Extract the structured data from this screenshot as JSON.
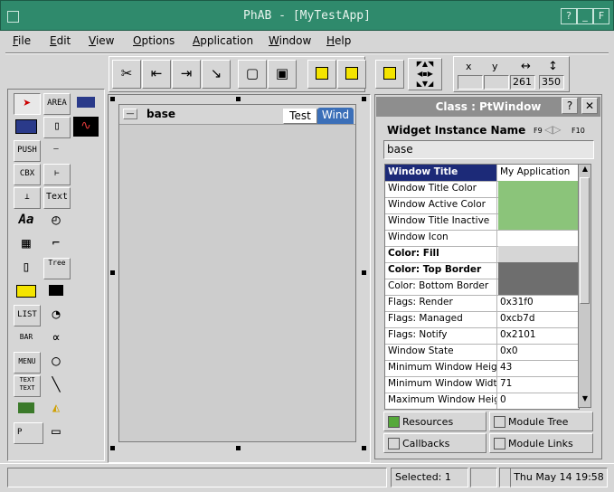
{
  "window": {
    "title": "PhAB - [MyTestApp]"
  },
  "menubar": {
    "items": [
      {
        "label": "File",
        "accel": "F"
      },
      {
        "label": "Edit",
        "accel": "E"
      },
      {
        "label": "View",
        "accel": "V"
      },
      {
        "label": "Options",
        "accel": "O"
      },
      {
        "label": "Application",
        "accel": "A"
      },
      {
        "label": "Window",
        "accel": "W"
      },
      {
        "label": "Help",
        "accel": "H"
      }
    ]
  },
  "toolbar": {
    "coords": {
      "x_label": "x",
      "y_label": "y",
      "w_label": "↔",
      "h_label": "↕",
      "x": "",
      "y": "",
      "w": "261",
      "h": "350"
    }
  },
  "palette": {
    "area": "AREA",
    "push": "PUSH",
    "cbx": "CBX",
    "text": "Text",
    "aa": "Aa",
    "tree_label": "Tree",
    "list": "LIST",
    "bar": "BAR",
    "menu": "MENU",
    "text_text": "TEXT TEXT",
    "p": "P"
  },
  "base_window": {
    "title": "base",
    "tabs": [
      "Test",
      "Wind"
    ]
  },
  "class_panel": {
    "title": "Class : PtWindow",
    "instance_label": "Widget Instance Name",
    "f9": "F9",
    "f10": "F10",
    "instance_value": "base",
    "resources": [
      {
        "name": "Window Title",
        "value": "My Application",
        "selected": true
      },
      {
        "name": "Window Title Color",
        "value": "",
        "swatch": "#8bc47a"
      },
      {
        "name": "Window Active Color",
        "value": "",
        "swatch": "#8bc47a"
      },
      {
        "name": "Window Title Inactive",
        "value": "",
        "swatch": "#8bc47a"
      },
      {
        "name": "Window Icon",
        "value": ""
      },
      {
        "name": "Color: Fill",
        "value": "",
        "swatch": "#d6d6d6",
        "bold": true
      },
      {
        "name": "Color: Top Border",
        "value": "",
        "swatch": "#6e6e6e",
        "bold": true
      },
      {
        "name": "Color: Bottom Border",
        "value": "",
        "swatch": "#6e6e6e"
      },
      {
        "name": "Flags: Render",
        "value": "0x31f0"
      },
      {
        "name": "Flags: Managed",
        "value": "0xcb7d"
      },
      {
        "name": "Flags: Notify",
        "value": "0x2101"
      },
      {
        "name": "Window State",
        "value": "0x0"
      },
      {
        "name": "Minimum Window Height",
        "value": "43"
      },
      {
        "name": "Minimum Window Width",
        "value": "71"
      },
      {
        "name": "Maximum Window Height",
        "value": "0"
      }
    ],
    "buttons": [
      {
        "label": "Resources",
        "accel": "R",
        "checked": true
      },
      {
        "label": "Module Tree",
        "accel": "T",
        "checked": false
      },
      {
        "label": "Callbacks",
        "accel": "C",
        "checked": false
      },
      {
        "label": "Module Links",
        "accel": "L",
        "checked": false
      }
    ]
  },
  "status": {
    "selected": "Selected: 1",
    "datetime": "Thu May 14 19:58"
  }
}
